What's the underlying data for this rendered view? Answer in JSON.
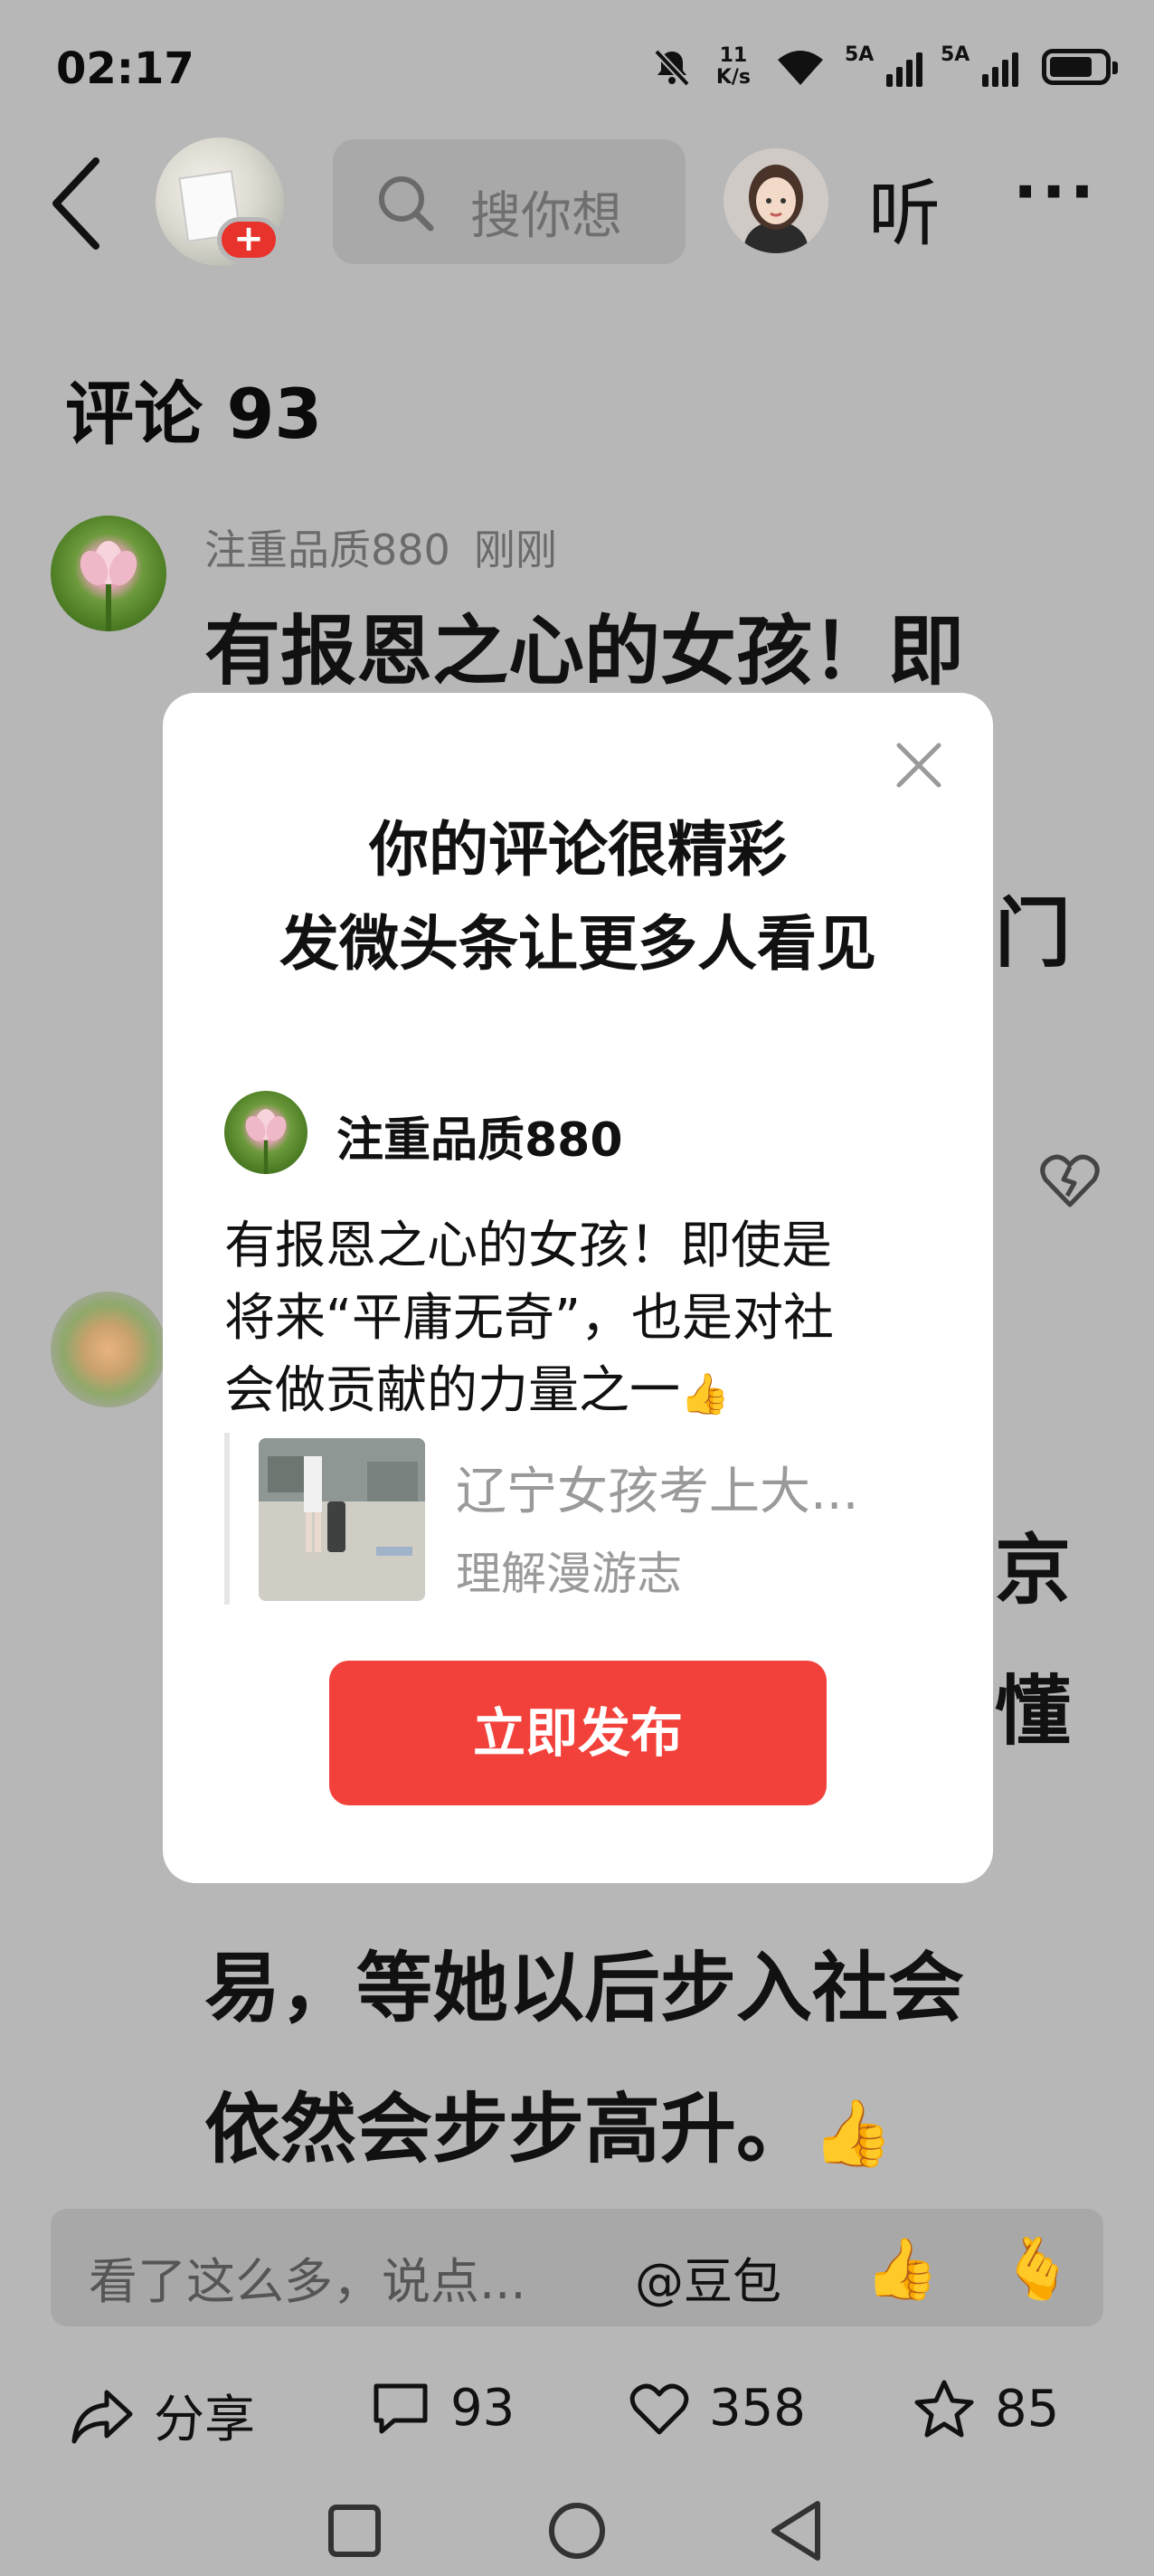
{
  "status_bar": {
    "time": "02:17",
    "net_speed_value": "11",
    "net_speed_unit": "K/s",
    "sim1_label": "5A",
    "sim2_label": "5A",
    "battery_level": 0.8
  },
  "top_nav": {
    "follow_label": "+",
    "search_placeholder": "搜你想",
    "listen_label": "听",
    "more_label": "···"
  },
  "comments": {
    "title": "评论 93",
    "items": [
      {
        "username": "注重品质880",
        "time": "刚刚",
        "lines": [
          "有报恩之心的女孩！即",
          "",
          "",
          "",
          "",
          "",
          "",
          "易，等她以后步入社会",
          "依然会步步高升。"
        ],
        "emoji": "👍"
      }
    ],
    "partial_text_right": [
      "门",
      "京",
      "懂"
    ]
  },
  "modal": {
    "close_label": "×",
    "headline_1": "你的评论很精彩",
    "headline_2": "发微头条让更多人看见",
    "username": "注重品质880",
    "comment_line_1": "有报恩之心的女孩！即使是",
    "comment_line_2": "将来“平庸无奇”，也是对社",
    "comment_line_3": "会做贡献的力量之一",
    "comment_emoji": "👍",
    "ref_title": "辽宁女孩考上大...",
    "ref_source": "理解漫游志",
    "publish_label": "立即发布"
  },
  "comment_bar": {
    "placeholder": "看了这么多，说点...",
    "mention": "@豆包",
    "emoji_1": "👍",
    "emoji_2": "🫰"
  },
  "actions": {
    "share_label": "分享",
    "comment_count": "93",
    "like_count": "358",
    "favorite_count": "85"
  },
  "colors": {
    "overlay_bg": "#b7b7b7",
    "publish_red": "#f2413a",
    "follow_red": "#e8322c"
  }
}
